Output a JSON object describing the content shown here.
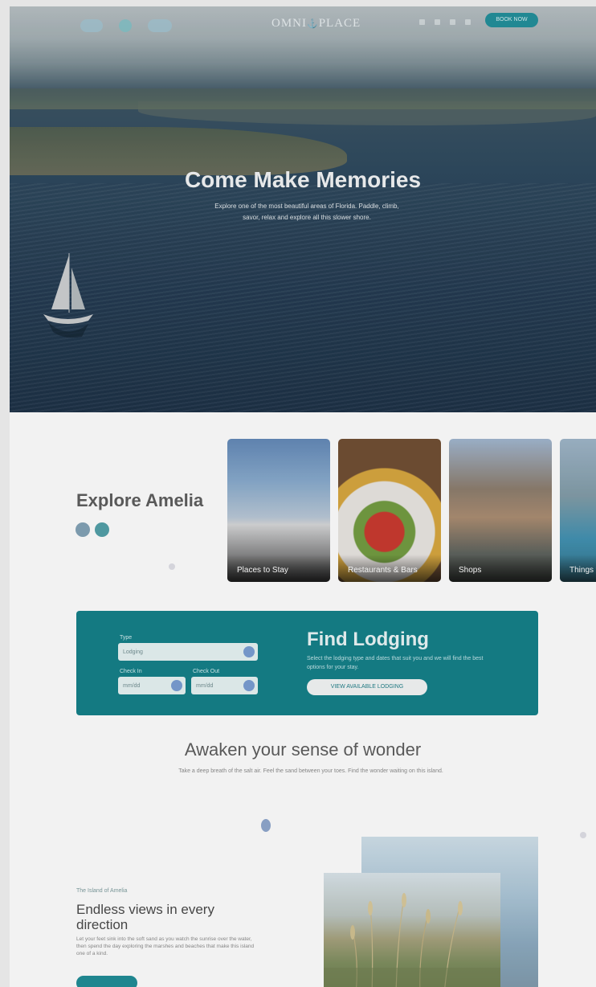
{
  "header": {
    "logo_text": "OMNI",
    "logo_text_after": "PLACE",
    "cta_label": "BOOK NOW",
    "icons": [
      "social-icon-1",
      "social-icon-2",
      "social-icon-3",
      "social-icon-4"
    ]
  },
  "hero": {
    "title": "Come Make Memories",
    "subtitle": "Explore one of the most beautiful areas of Florida. Paddle, climb, savor, relax and explore all this slower shore."
  },
  "explore": {
    "title": "Explore Amelia",
    "cards": [
      {
        "label": "Places to Stay"
      },
      {
        "label": "Restaurants & Bars"
      },
      {
        "label": "Shops"
      },
      {
        "label": "Things to Do"
      }
    ]
  },
  "lodging": {
    "type_label": "Type",
    "type_value": "Lodging",
    "checkin_label": "Check In",
    "checkin_value": "mm/dd",
    "checkout_label": "Check Out",
    "checkout_value": "mm/dd",
    "title": "Find Lodging",
    "text": "Select the lodging type and dates that suit you and we will find the best options for your stay.",
    "button_label": "VIEW AVAILABLE LODGING"
  },
  "awaken": {
    "title": "Awaken your sense of wonder",
    "subtitle": "Take a deep breath of the salt air. Feel the sand between your toes. Find the wonder waiting on this island."
  },
  "endless": {
    "eyebrow": "The Island of Amelia",
    "title": "Endless views in every direction",
    "text": "Let your feet sink into the soft sand as you watch the sunrise over the water, then spend the day exploring the marshes and beaches that make this island one of a kind."
  },
  "colors": {
    "teal": "#0f7d86",
    "cta": "#1d8d98",
    "heading": "#5a5a5a"
  }
}
